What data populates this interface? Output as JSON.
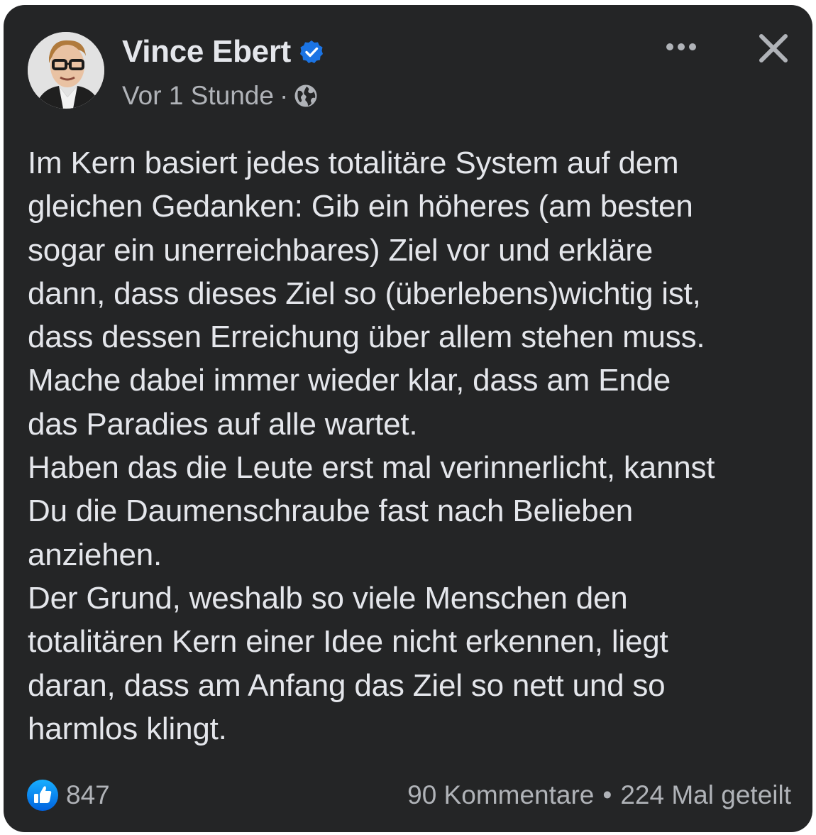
{
  "post": {
    "author": {
      "name": "Vince Ebert",
      "verified": true,
      "avatar_icon": "profile-photo"
    },
    "timestamp": "Vor 1 Stunde",
    "separator": "·",
    "audience_icon": "globe-icon",
    "text": "Im Kern basiert jedes totalitäre System auf dem\ngleichen Gedanken: Gib ein höheres (am besten\nsogar ein unerreichbares) Ziel vor und erkläre\ndann, dass dieses Ziel so (überlebens)wichtig ist,\ndass dessen Erreichung über allem stehen muss.\nMache dabei immer wieder klar, dass am Ende\ndas Paradies auf alle wartet.\nHaben das die Leute erst mal verinnerlicht, kannst\nDu die Daumenschraube fast nach Belieben\nanziehen.\nDer Grund, weshalb so viele Menschen den\ntotalitären Kern einer Idee nicht erkennen, liegt\ndaran, dass am Anfang das Ziel so nett und so\nharmlos klingt.",
    "likes": "847",
    "comments": "90 Kommentare",
    "stats_separator": "•",
    "shares": "224 Mal geteilt"
  },
  "colors": {
    "card_background": "#242526",
    "primary_text": "#e4e6eb",
    "secondary_text": "#b0b3b8",
    "accent_blue": "#1b74e4"
  }
}
